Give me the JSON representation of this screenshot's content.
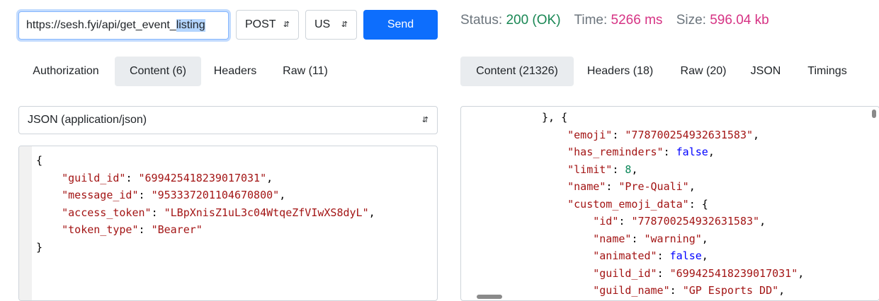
{
  "request": {
    "url": "https://sesh.fyi/api/get_event_listing",
    "url_visible_prefix": "https://sesh.fyi/api/get_event_",
    "url_visible_selected": "listing",
    "method": "POST",
    "region": "US",
    "send_label": "Send"
  },
  "status": {
    "status_label": "Status:",
    "status_value": "200 (OK)",
    "time_label": "Time:",
    "time_value": "5266 ms",
    "size_label": "Size:",
    "size_value": "596.04 kb"
  },
  "request_tabs": [
    {
      "label": "Authorization",
      "active": false
    },
    {
      "label": "Content (6)",
      "active": true
    },
    {
      "label": "Headers",
      "active": false
    },
    {
      "label": "Raw (11)",
      "active": false
    }
  ],
  "response_tabs": [
    {
      "label": "Content (21326)",
      "active": true
    },
    {
      "label": "Headers (18)",
      "active": false
    },
    {
      "label": "Raw (20)",
      "active": false
    },
    {
      "label": "JSON",
      "active": false
    },
    {
      "label": "Timings",
      "active": false
    }
  ],
  "content_type": "JSON (application/json)",
  "request_body": [
    {
      "t": "{"
    },
    {
      "key": "guild_id",
      "val": "\"699425418239017031\"",
      "vt": "s",
      "comma": true
    },
    {
      "key": "message_id",
      "val": "\"953337201104670800\"",
      "vt": "s",
      "comma": true
    },
    {
      "key": "access_token",
      "val": "\"LBpXnisZ1uL3c04WtqeZfVIwXS8dyL\"",
      "vt": "s",
      "comma": true
    },
    {
      "key": "token_type",
      "val": "\"Bearer\"",
      "vt": "s",
      "comma": false
    },
    {
      "t": "}"
    }
  ],
  "response_body": [
    {
      "indent": 0,
      "t": "}, {"
    },
    {
      "indent": 1,
      "key": "emoji",
      "val": "\"778700254932631583\"",
      "vt": "s",
      "comma": true
    },
    {
      "indent": 1,
      "key": "has_reminders",
      "val": "false",
      "vt": "b",
      "comma": true
    },
    {
      "indent": 1,
      "key": "limit",
      "val": "8",
      "vt": "n",
      "comma": true
    },
    {
      "indent": 1,
      "key": "name",
      "val": "\"Pre-Quali\"",
      "vt": "s",
      "comma": true
    },
    {
      "indent": 1,
      "key": "custom_emoji_data",
      "val": "{",
      "vt": "p",
      "comma": false
    },
    {
      "indent": 2,
      "key": "id",
      "val": "\"778700254932631583\"",
      "vt": "s",
      "comma": true
    },
    {
      "indent": 2,
      "key": "name",
      "val": "\"warning\"",
      "vt": "s",
      "comma": true
    },
    {
      "indent": 2,
      "key": "animated",
      "val": "false",
      "vt": "b",
      "comma": true
    },
    {
      "indent": 2,
      "key": "guild_id",
      "val": "\"699425418239017031\"",
      "vt": "s",
      "comma": true
    },
    {
      "indent": 2,
      "key": "guild_name",
      "val": "\"GP Esports DD\"",
      "vt": "s",
      "comma": true
    }
  ]
}
